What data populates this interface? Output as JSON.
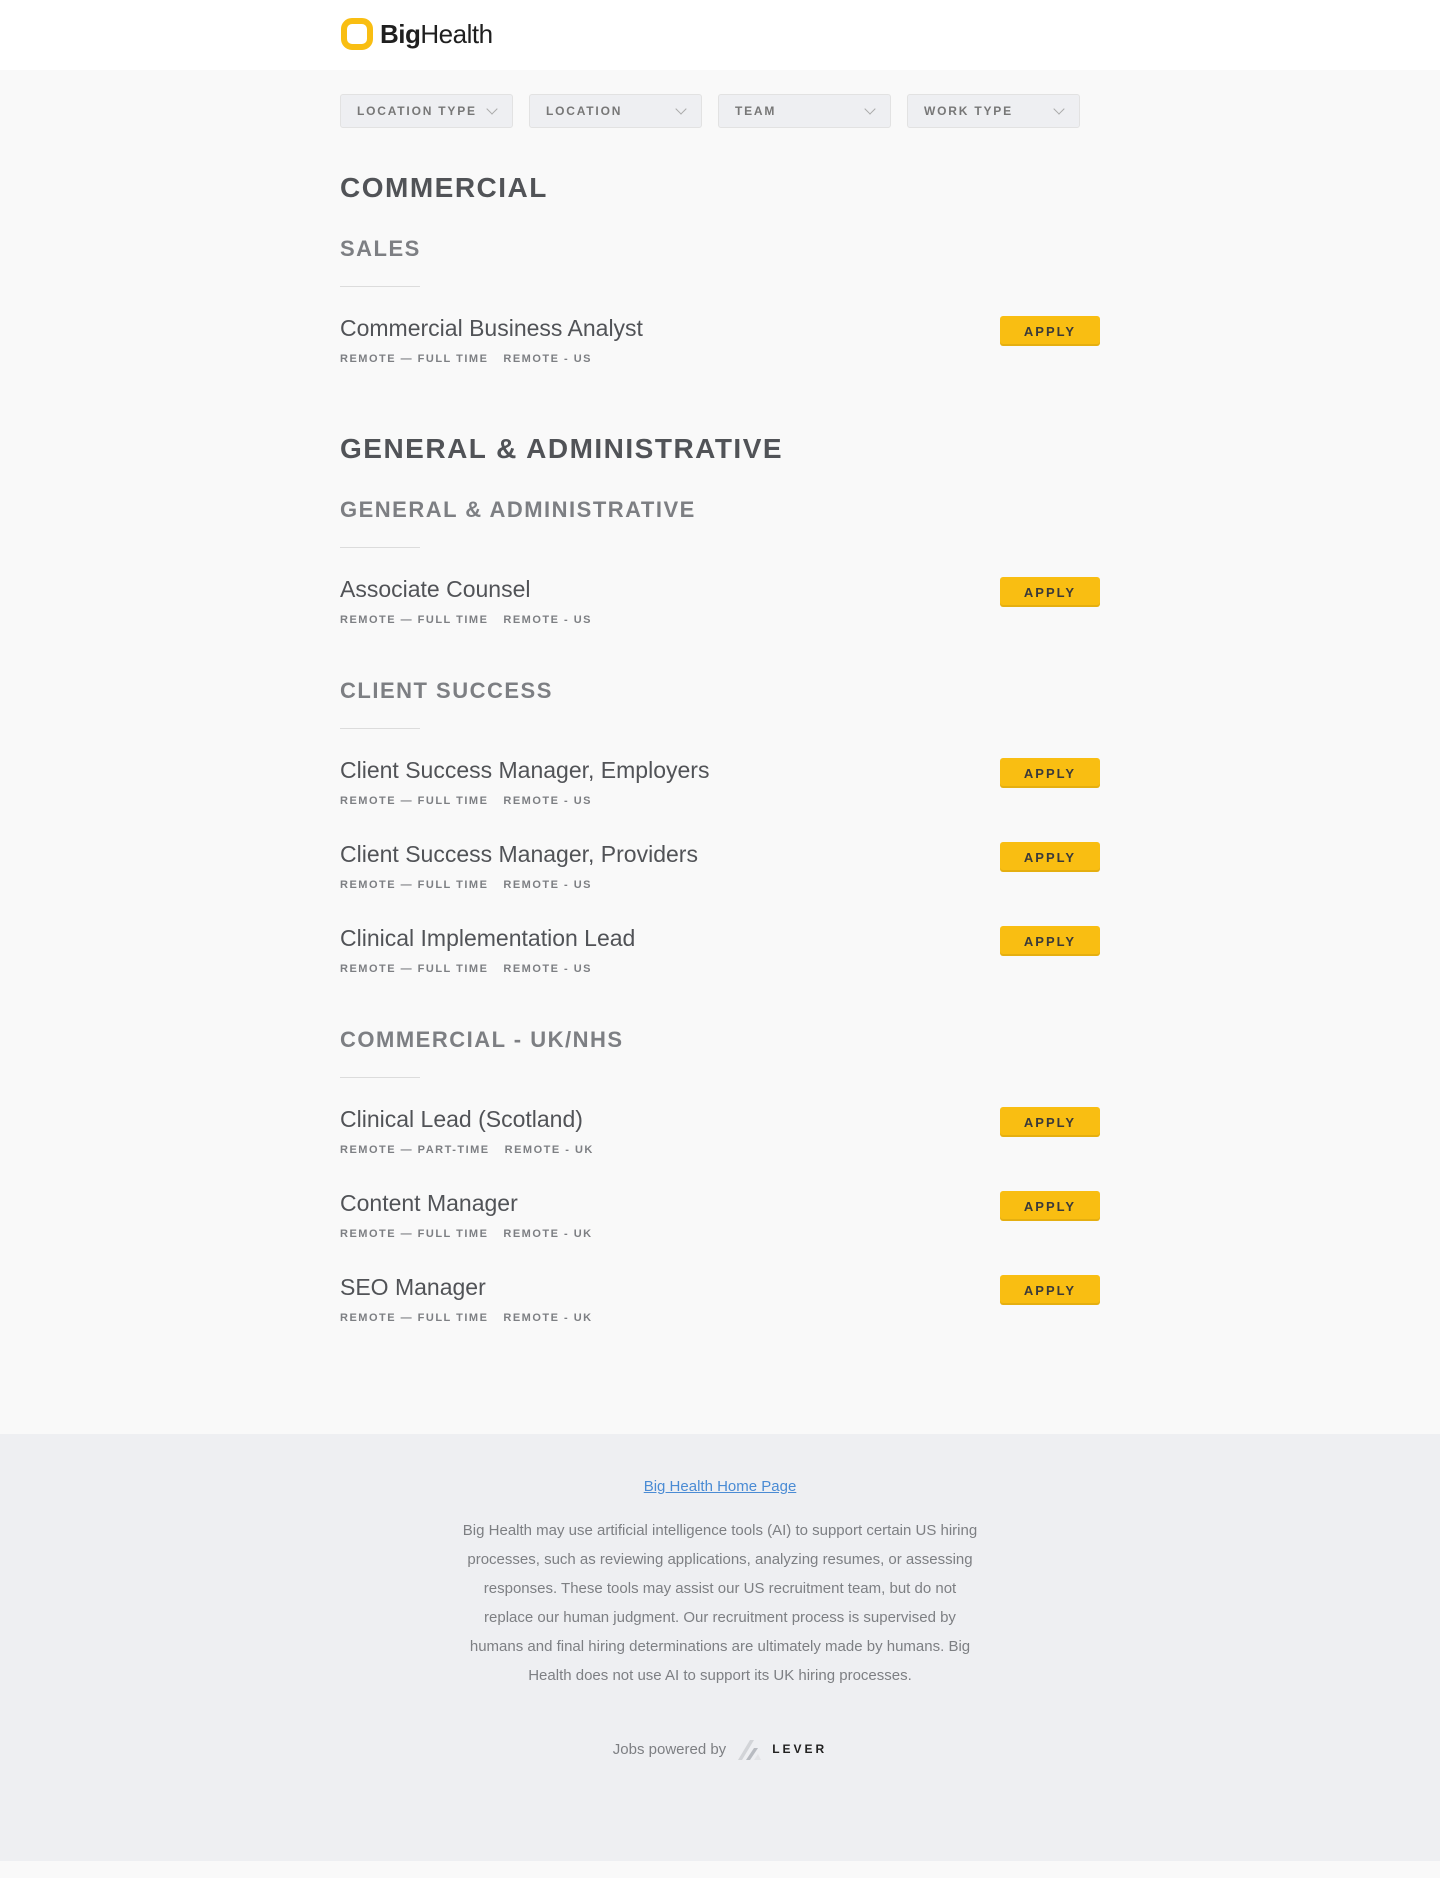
{
  "brand": {
    "name_bold": "Big",
    "name_light": "Health",
    "accent_color": "#f9be12",
    "logo_icon": "rounded-square-ring-logo"
  },
  "filters": [
    {
      "label": "LOCATION TYPE",
      "icon": "chevron-down-icon"
    },
    {
      "label": "LOCATION",
      "icon": "chevron-down-icon"
    },
    {
      "label": "TEAM",
      "icon": "chevron-down-icon"
    },
    {
      "label": "WORK TYPE",
      "icon": "chevron-down-icon"
    }
  ],
  "apply_label": "APPLY",
  "departments": [
    {
      "name": "COMMERCIAL",
      "teams": [
        {
          "name": "SALES",
          "postings": [
            {
              "title": "Commercial Business Analyst",
              "commitment": "REMOTE — FULL TIME",
              "location": "REMOTE - US"
            }
          ]
        }
      ]
    },
    {
      "name": "GENERAL & ADMINISTRATIVE",
      "teams": [
        {
          "name": "GENERAL & ADMINISTRATIVE",
          "postings": [
            {
              "title": "Associate Counsel",
              "commitment": "REMOTE — FULL TIME",
              "location": "REMOTE - US"
            }
          ]
        },
        {
          "name": "CLIENT SUCCESS",
          "postings": [
            {
              "title": "Client Success Manager, Employers",
              "commitment": "REMOTE — FULL TIME",
              "location": "REMOTE - US"
            },
            {
              "title": "Client Success Manager, Providers",
              "commitment": "REMOTE — FULL TIME",
              "location": "REMOTE - US"
            },
            {
              "title": "Clinical Implementation Lead",
              "commitment": "REMOTE — FULL TIME",
              "location": "REMOTE - US"
            }
          ]
        },
        {
          "name": "COMMERCIAL - UK/NHS",
          "postings": [
            {
              "title": "Clinical Lead (Scotland)",
              "commitment": "REMOTE — PART-TIME",
              "location": "REMOTE - UK"
            },
            {
              "title": "Content Manager",
              "commitment": "REMOTE — FULL TIME",
              "location": "REMOTE - UK"
            },
            {
              "title": "SEO Manager",
              "commitment": "REMOTE — FULL TIME",
              "location": "REMOTE - UK"
            }
          ]
        }
      ]
    }
  ],
  "footer": {
    "home_link": "Big Health Home Page",
    "disclaimer": "Big Health may use artificial intelligence tools (AI) to support certain US hiring processes, such as reviewing applications, analyzing resumes, or assessing responses. These tools may assist our US recruitment team, but do not replace our human judgment. Our recruitment process is supervised by humans and final hiring determinations are ultimately made by humans. Big Health does not use AI to support its UK hiring processes.",
    "powered_by": "Jobs powered by",
    "lever_word": "LEVER"
  }
}
